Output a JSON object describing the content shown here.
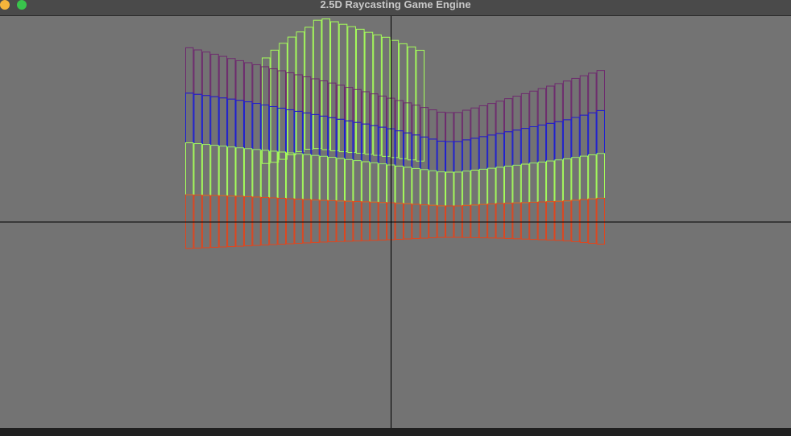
{
  "window": {
    "title": "2.5D Raycasting Game Engine",
    "buttons": [
      {
        "name": "close",
        "color": "#f5b43b"
      },
      {
        "name": "zoom",
        "color": "#39c44c"
      }
    ]
  },
  "scene": {
    "background": "#737373",
    "crosshair_color": "#000000",
    "layer_colors": {
      "back_wall": "#a6ff5a",
      "top": "#6e2a6e",
      "middle": "#1e1ed2",
      "lower": "#a6ff5a",
      "bottom": "#e0461e"
    }
  }
}
